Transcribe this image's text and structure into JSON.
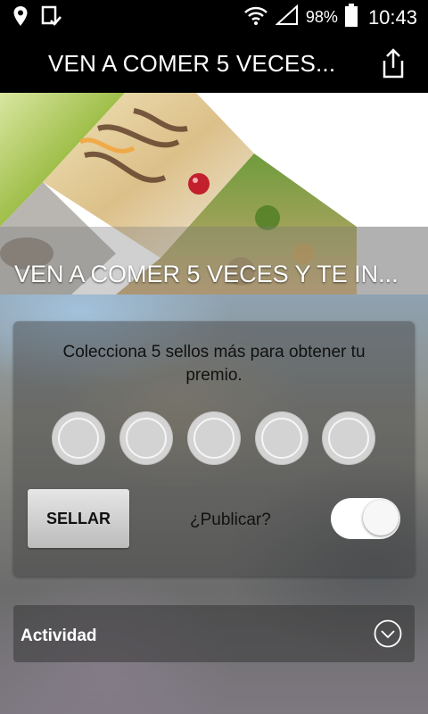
{
  "status_bar": {
    "battery": "98%",
    "time": "10:43",
    "icons": [
      "location-pin-icon",
      "task-check-icon",
      "wifi-icon",
      "signal-icon",
      "battery-icon"
    ]
  },
  "app_bar": {
    "title": "VEN A COMER 5 VECES...",
    "share_icon": "share-icon"
  },
  "hero": {
    "caption": "VEN A COMER  5 VECES Y TE IN..."
  },
  "card": {
    "message": "Colecciona 5 sellos más para obtener tu premio.",
    "stamps_total": 5,
    "stamps_filled": 0,
    "sellar_label": "SELLAR",
    "publish_label": "¿Publicar?",
    "publish_toggle": "on"
  },
  "activity": {
    "label": "Actividad",
    "icon": "chevron-down-circle-icon"
  },
  "colors": {
    "status_bar_bg": "#000000",
    "app_bar_bg": "#000000",
    "stamp_fill": "#d3d3d3"
  }
}
